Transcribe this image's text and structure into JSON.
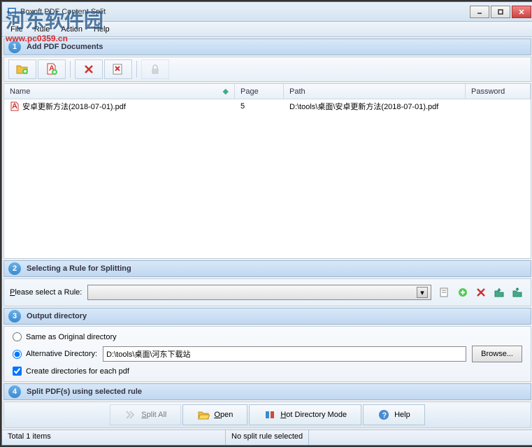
{
  "window": {
    "title": "Boxoft PDF Content Split"
  },
  "menu": {
    "file": "File",
    "rule": "Rule",
    "action": "Action",
    "help": "Help"
  },
  "watermark": {
    "text": "河东软件园",
    "url": "www.pc0359.cn"
  },
  "section1": {
    "num": "1",
    "title": "Add PDF Documents"
  },
  "columns": {
    "name": "Name",
    "page": "Page",
    "path": "Path",
    "password": "Password"
  },
  "files": [
    {
      "name": "安卓更新方法(2018-07-01).pdf",
      "page": "5",
      "path": "D:\\tools\\桌面\\安卓更新方法(2018-07-01).pdf",
      "password": ""
    }
  ],
  "section2": {
    "num": "2",
    "title": "Selecting a Rule for Splitting",
    "label": "Please select a Rule:",
    "selected": ""
  },
  "section3": {
    "num": "3",
    "title": "Output directory",
    "opt_same": "Same as Original directory",
    "opt_alt": "Alternative Directory:",
    "alt_path": "D:\\tools\\桌面\\河东下载站",
    "create_dirs": "Create directories for each pdf",
    "browse": "Browse..."
  },
  "section4": {
    "num": "4",
    "title": "Split PDF(s) using selected rule"
  },
  "actions": {
    "split_all": "Split All",
    "open": "Open",
    "hot_dir": "Hot Directory Mode",
    "help": "Help"
  },
  "status": {
    "total": "Total 1 items",
    "rule": "No split rule selected"
  }
}
